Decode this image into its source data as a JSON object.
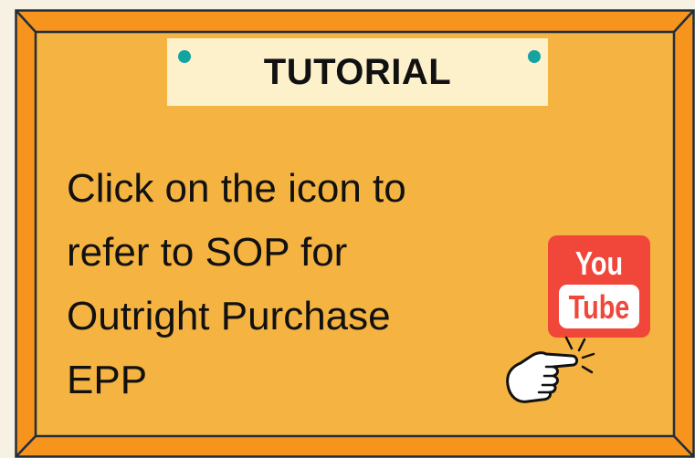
{
  "board": {
    "title": "TUTORIAL",
    "instruction_lines": [
      "Click on the icon to",
      "refer to SOP for",
      "Outright Purchase",
      "EPP"
    ]
  },
  "youtube_button": {
    "top_text": "You",
    "bottom_text": "Tube"
  },
  "colors": {
    "frame": "#f7941d",
    "board_fill": "#f5b341",
    "note": "#fdf1cc",
    "pin": "#14a3a0",
    "youtube_red": "#f1463a"
  },
  "icons": [
    "pin-icon",
    "youtube-icon",
    "pointing-hand-icon"
  ]
}
